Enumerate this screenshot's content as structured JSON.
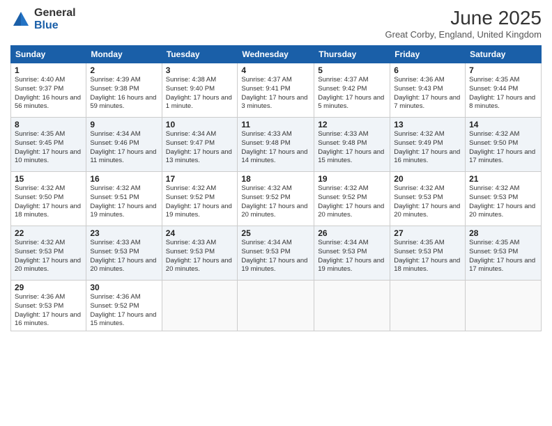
{
  "logo": {
    "general": "General",
    "blue": "Blue"
  },
  "title": "June 2025",
  "location": "Great Corby, England, United Kingdom",
  "days_of_week": [
    "Sunday",
    "Monday",
    "Tuesday",
    "Wednesday",
    "Thursday",
    "Friday",
    "Saturday"
  ],
  "weeks": [
    [
      {
        "day": "1",
        "sunrise": "4:40 AM",
        "sunset": "9:37 PM",
        "daylight": "16 hours and 56 minutes."
      },
      {
        "day": "2",
        "sunrise": "4:39 AM",
        "sunset": "9:38 PM",
        "daylight": "16 hours and 59 minutes."
      },
      {
        "day": "3",
        "sunrise": "4:38 AM",
        "sunset": "9:40 PM",
        "daylight": "17 hours and 1 minute."
      },
      {
        "day": "4",
        "sunrise": "4:37 AM",
        "sunset": "9:41 PM",
        "daylight": "17 hours and 3 minutes."
      },
      {
        "day": "5",
        "sunrise": "4:37 AM",
        "sunset": "9:42 PM",
        "daylight": "17 hours and 5 minutes."
      },
      {
        "day": "6",
        "sunrise": "4:36 AM",
        "sunset": "9:43 PM",
        "daylight": "17 hours and 7 minutes."
      },
      {
        "day": "7",
        "sunrise": "4:35 AM",
        "sunset": "9:44 PM",
        "daylight": "17 hours and 8 minutes."
      }
    ],
    [
      {
        "day": "8",
        "sunrise": "4:35 AM",
        "sunset": "9:45 PM",
        "daylight": "17 hours and 10 minutes."
      },
      {
        "day": "9",
        "sunrise": "4:34 AM",
        "sunset": "9:46 PM",
        "daylight": "17 hours and 11 minutes."
      },
      {
        "day": "10",
        "sunrise": "4:34 AM",
        "sunset": "9:47 PM",
        "daylight": "17 hours and 13 minutes."
      },
      {
        "day": "11",
        "sunrise": "4:33 AM",
        "sunset": "9:48 PM",
        "daylight": "17 hours and 14 minutes."
      },
      {
        "day": "12",
        "sunrise": "4:33 AM",
        "sunset": "9:48 PM",
        "daylight": "17 hours and 15 minutes."
      },
      {
        "day": "13",
        "sunrise": "4:32 AM",
        "sunset": "9:49 PM",
        "daylight": "17 hours and 16 minutes."
      },
      {
        "day": "14",
        "sunrise": "4:32 AM",
        "sunset": "9:50 PM",
        "daylight": "17 hours and 17 minutes."
      }
    ],
    [
      {
        "day": "15",
        "sunrise": "4:32 AM",
        "sunset": "9:50 PM",
        "daylight": "17 hours and 18 minutes."
      },
      {
        "day": "16",
        "sunrise": "4:32 AM",
        "sunset": "9:51 PM",
        "daylight": "17 hours and 19 minutes."
      },
      {
        "day": "17",
        "sunrise": "4:32 AM",
        "sunset": "9:52 PM",
        "daylight": "17 hours and 19 minutes."
      },
      {
        "day": "18",
        "sunrise": "4:32 AM",
        "sunset": "9:52 PM",
        "daylight": "17 hours and 20 minutes."
      },
      {
        "day": "19",
        "sunrise": "4:32 AM",
        "sunset": "9:52 PM",
        "daylight": "17 hours and 20 minutes."
      },
      {
        "day": "20",
        "sunrise": "4:32 AM",
        "sunset": "9:53 PM",
        "daylight": "17 hours and 20 minutes."
      },
      {
        "day": "21",
        "sunrise": "4:32 AM",
        "sunset": "9:53 PM",
        "daylight": "17 hours and 20 minutes."
      }
    ],
    [
      {
        "day": "22",
        "sunrise": "4:32 AM",
        "sunset": "9:53 PM",
        "daylight": "17 hours and 20 minutes."
      },
      {
        "day": "23",
        "sunrise": "4:33 AM",
        "sunset": "9:53 PM",
        "daylight": "17 hours and 20 minutes."
      },
      {
        "day": "24",
        "sunrise": "4:33 AM",
        "sunset": "9:53 PM",
        "daylight": "17 hours and 20 minutes."
      },
      {
        "day": "25",
        "sunrise": "4:34 AM",
        "sunset": "9:53 PM",
        "daylight": "17 hours and 19 minutes."
      },
      {
        "day": "26",
        "sunrise": "4:34 AM",
        "sunset": "9:53 PM",
        "daylight": "17 hours and 19 minutes."
      },
      {
        "day": "27",
        "sunrise": "4:35 AM",
        "sunset": "9:53 PM",
        "daylight": "17 hours and 18 minutes."
      },
      {
        "day": "28",
        "sunrise": "4:35 AM",
        "sunset": "9:53 PM",
        "daylight": "17 hours and 17 minutes."
      }
    ],
    [
      {
        "day": "29",
        "sunrise": "4:36 AM",
        "sunset": "9:53 PM",
        "daylight": "17 hours and 16 minutes."
      },
      {
        "day": "30",
        "sunrise": "4:36 AM",
        "sunset": "9:52 PM",
        "daylight": "17 hours and 15 minutes."
      },
      null,
      null,
      null,
      null,
      null
    ]
  ]
}
